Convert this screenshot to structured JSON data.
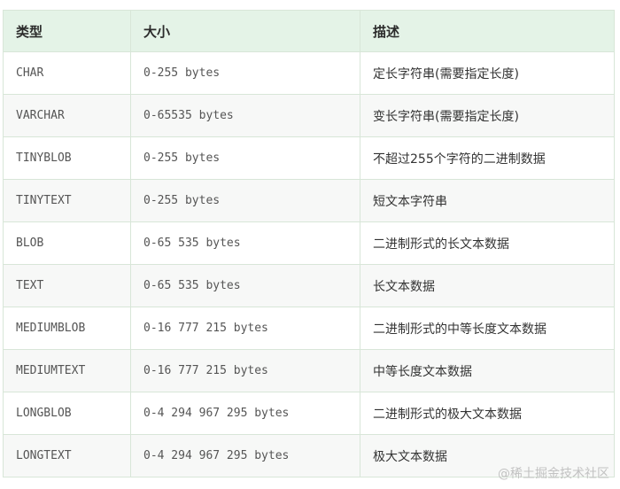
{
  "table": {
    "headers": [
      "类型",
      "大小",
      "描述"
    ],
    "rows": [
      {
        "type": "CHAR",
        "size": "0-255 bytes",
        "desc": "定长字符串(需要指定长度)"
      },
      {
        "type": "VARCHAR",
        "size": "0-65535 bytes",
        "desc": "变长字符串(需要指定长度)"
      },
      {
        "type": "TINYBLOB",
        "size": "0-255 bytes",
        "desc": "不超过255个字符的二进制数据"
      },
      {
        "type": "TINYTEXT",
        "size": "0-255 bytes",
        "desc": "短文本字符串"
      },
      {
        "type": "BLOB",
        "size": "0-65 535 bytes",
        "desc": "二进制形式的长文本数据"
      },
      {
        "type": "TEXT",
        "size": "0-65 535 bytes",
        "desc": "长文本数据"
      },
      {
        "type": "MEDIUMBLOB",
        "size": "0-16 777 215 bytes",
        "desc": "二进制形式的中等长度文本数据"
      },
      {
        "type": "MEDIUMTEXT",
        "size": "0-16 777 215 bytes",
        "desc": "中等长度文本数据"
      },
      {
        "type": "LONGBLOB",
        "size": "0-4 294 967 295 bytes",
        "desc": "二进制形式的极大文本数据"
      },
      {
        "type": "LONGTEXT",
        "size": "0-4 294 967 295 bytes",
        "desc": "极大文本数据"
      }
    ]
  },
  "watermark": {
    "text": "@稀土掘金技术社区"
  }
}
